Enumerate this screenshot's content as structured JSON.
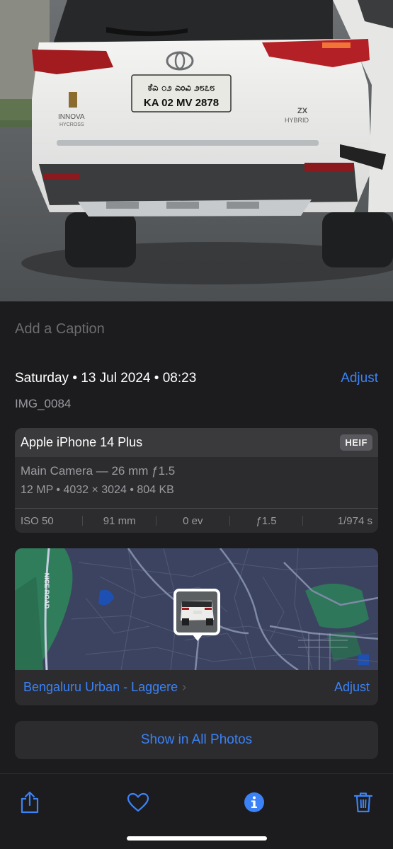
{
  "photo": {
    "plate_line1": "ಕೆಎ ೦೨ ಎಂವಿ ೨೮೭೮",
    "plate_line2": "KA 02 MV 2878",
    "badge_left": "INNOVA",
    "badge_left_sub": "HYCROSS",
    "badge_right": "ZX",
    "badge_right_sub": "HYBRID"
  },
  "caption": {
    "placeholder": "Add a Caption"
  },
  "info": {
    "date": "Saturday • 13 Jul 2024 • 08:23",
    "adjust_label": "Adjust",
    "filename": "IMG_0084"
  },
  "exif": {
    "device": "Apple iPhone 14 Plus",
    "format": "HEIF",
    "lens": "Main Camera — 26 mm ƒ1.5",
    "specs": "12 MP  •  4032 × 3024  •  804 KB",
    "iso": "ISO 50",
    "focal": "91 mm",
    "ev": "0 ev",
    "aperture": "ƒ1.5",
    "shutter": "1/974 s"
  },
  "map": {
    "road_label": "NICE ROAD",
    "location": "Bengaluru Urban - Laggere",
    "adjust_label": "Adjust"
  },
  "actions": {
    "show_all": "Show in All Photos"
  },
  "icons": [
    "share-icon",
    "heart-icon",
    "info-icon",
    "trash-icon",
    "chevron-right-icon"
  ],
  "colors": {
    "accent": "#3b82f6",
    "panel": "#1c1c1e",
    "card": "#2c2c2e",
    "map_bg": "#3b4360",
    "map_green": "#2f7d5a"
  }
}
